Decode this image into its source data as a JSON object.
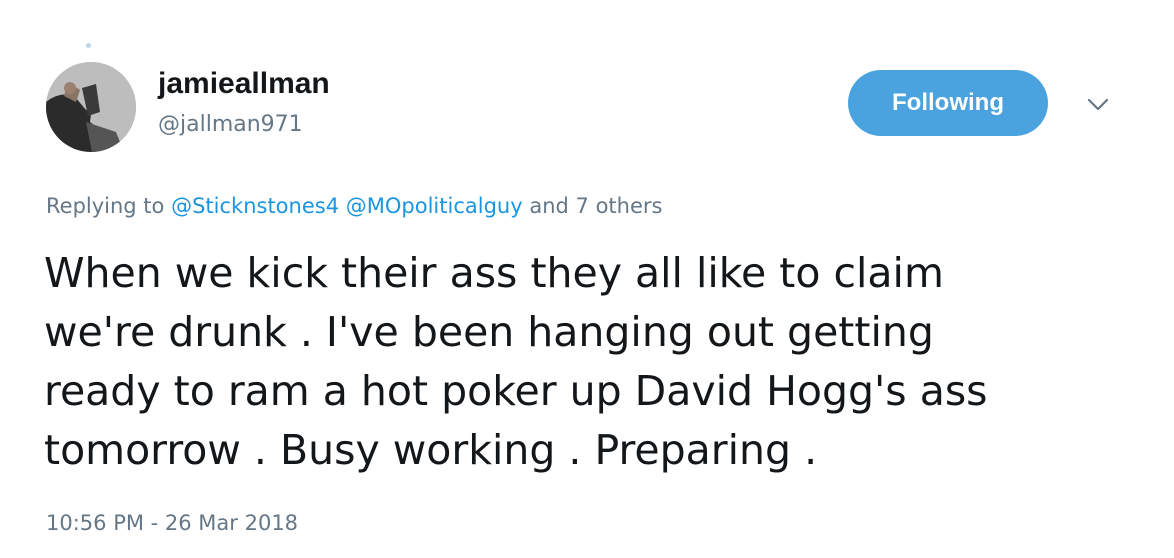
{
  "author": {
    "display_name": "jamieallman",
    "handle": "@jallman971"
  },
  "follow_button": {
    "label": "Following"
  },
  "menu_icon": "chevron-down-icon",
  "reply": {
    "prefix": "Replying to",
    "mentions": [
      "@Sticknstones4",
      "@MOpoliticalguy"
    ],
    "others": "and 7 others"
  },
  "tweet_text": {
    "lines": [
      "When we kick their ass they all like to claim",
      "we're drunk . I've been hanging out getting",
      "ready to ram a hot poker up David Hogg's ass",
      "tomorrow . Busy working . Preparing ."
    ]
  },
  "timestamp": "10:56 PM - 26 Mar 2018",
  "colors": {
    "accent": "#4aa3df",
    "link": "#1b95e0",
    "secondary_text": "#657786",
    "primary_text": "#14171a"
  }
}
